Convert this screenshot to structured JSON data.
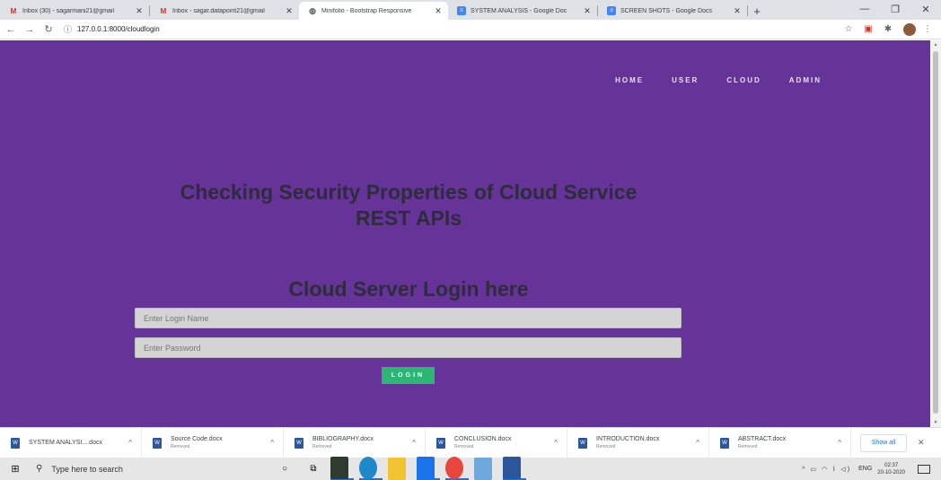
{
  "browser": {
    "tabs": [
      {
        "title": "Inbox (30) - sagarmani21@gmail",
        "icon": "gmail-icon",
        "active": false
      },
      {
        "title": "Inbox - sagar.datapoint21@gmail",
        "icon": "gmail-icon",
        "active": false
      },
      {
        "title": "Minifolio - Bootstrap Responsive",
        "icon": "globe-icon",
        "active": true
      },
      {
        "title": "SYSTEM ANALYSIS - Google Doc",
        "icon": "docs-icon",
        "active": false
      },
      {
        "title": "SCREEN SHOTS - Google Docs",
        "icon": "docs-icon",
        "active": false
      }
    ],
    "url": "127.0.0.1:8000/cloudlogin"
  },
  "site": {
    "nav": [
      "HOME",
      "USER",
      "CLOUD",
      "ADMIN"
    ],
    "hero_title_line1": "Checking Security Properties of Cloud Service",
    "hero_title_line2": "REST APIs",
    "login_title": "Cloud Server Login here",
    "login_name_placeholder": "Enter Login Name",
    "password_placeholder": "Enter Password",
    "login_button": "LOGIN",
    "background_color": "#663399",
    "button_color": "#2bb673"
  },
  "downloads": {
    "items": [
      {
        "name": "SYSTEM ANALYSI....docx",
        "status": ""
      },
      {
        "name": "Source Code.docx",
        "status": "Removed"
      },
      {
        "name": "BIBLIOGRAPHY.docx",
        "status": "Removed"
      },
      {
        "name": "CONCLUSION.docx",
        "status": "Removed"
      },
      {
        "name": "INTRODUCTION.docx",
        "status": "Removed"
      },
      {
        "name": "ABSTRACT.docx",
        "status": "Removed"
      }
    ],
    "show_all": "Show all"
  },
  "taskbar": {
    "search_placeholder": "Type here to search",
    "language": "ENG",
    "time": "02:37",
    "date": "20-10-2020"
  }
}
